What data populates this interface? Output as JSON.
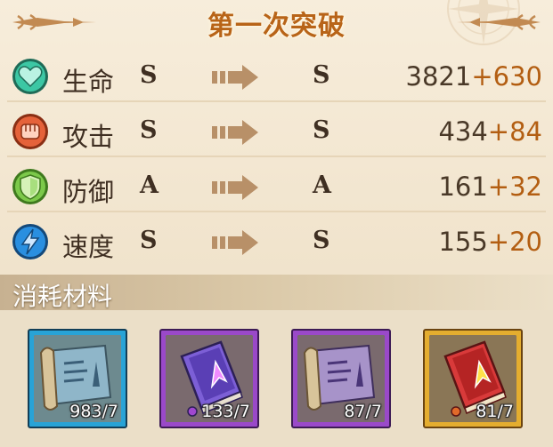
{
  "title": "第一次突破",
  "stats": [
    {
      "id": "hp",
      "icon": "heart-icon",
      "name": "生命",
      "from": "S",
      "to": "S",
      "base": "3821",
      "bonus": "+630"
    },
    {
      "id": "atk",
      "icon": "fist-icon",
      "name": "攻击",
      "from": "S",
      "to": "S",
      "base": "434",
      "bonus": "+84"
    },
    {
      "id": "def",
      "icon": "shield-icon",
      "name": "防御",
      "from": "A",
      "to": "A",
      "base": "161",
      "bonus": "+32"
    },
    {
      "id": "spd",
      "icon": "lightning-icon",
      "name": "速度",
      "from": "S",
      "to": "S",
      "base": "155",
      "bonus": "+20"
    }
  ],
  "materials": {
    "title": "消耗材料",
    "items": [
      {
        "icon": "scroll-icon",
        "rarity": "blue",
        "count": "983/7"
      },
      {
        "icon": "book-icon",
        "rarity": "purple",
        "count": "133/7"
      },
      {
        "icon": "scroll-icon",
        "rarity": "purple",
        "count": "87/7"
      },
      {
        "icon": "book-icon",
        "rarity": "gold",
        "count": "81/7"
      }
    ]
  },
  "colors": {
    "grade_text": "#3f2f22",
    "bonus": "#b35e12",
    "title": "#b86418",
    "hp_icon": "#3cc7a4",
    "atk_icon": "#e5623a",
    "def_icon": "#7cc94a",
    "spd_icon": "#2a8fe0"
  }
}
